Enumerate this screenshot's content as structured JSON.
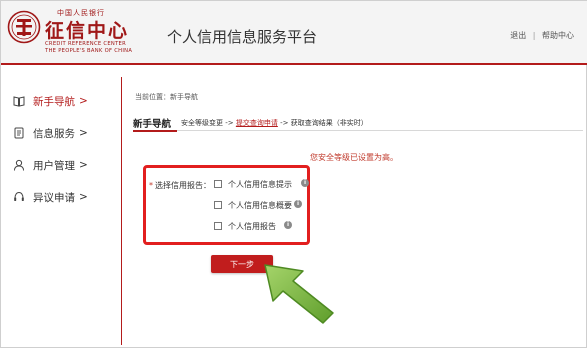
{
  "header": {
    "logo_cn_small": "中国人民银行",
    "logo_cn_big": "征信中心",
    "logo_en_line1": "CREDIT REFERENCE CENTER",
    "logo_en_line2": "THE PEOPLE'S BANK OF CHINA",
    "platform_title": "个人信用信息服务平台",
    "logout_label": "退出",
    "separator": "|",
    "help_label": "帮助中心"
  },
  "sidebar": {
    "items": [
      {
        "label": "新手导航",
        "arrow": ">",
        "icon": "book-icon",
        "active": true
      },
      {
        "label": "信息服务",
        "arrow": ">",
        "icon": "document-icon",
        "active": false
      },
      {
        "label": "用户管理",
        "arrow": ">",
        "icon": "user-icon",
        "active": false
      },
      {
        "label": "异议申请",
        "arrow": ">",
        "icon": "headset-icon",
        "active": false
      }
    ]
  },
  "main": {
    "breadcrumb": "当前位置：新手导航",
    "steps_title": "新手导航",
    "step1": "安全等级变更 ->",
    "step2": "提交查询申请",
    "step3": "-> 获取查询结果（非实时）",
    "security_message": "您安全等级已设置为高。",
    "form_star": "*",
    "form_label": "选择信用报告：",
    "options": [
      {
        "label": "个人信用信息提示",
        "checked": false
      },
      {
        "label": "个人信用信息概要",
        "checked": false
      },
      {
        "label": "个人信用报告",
        "checked": false
      }
    ],
    "info_glyph": "i",
    "next_button": "下一步"
  },
  "colors": {
    "brand_red": "#b31b1b",
    "highlight_red": "#e21f1f",
    "button_red": "#c11d1d",
    "arrow_green": "#7cb342"
  }
}
